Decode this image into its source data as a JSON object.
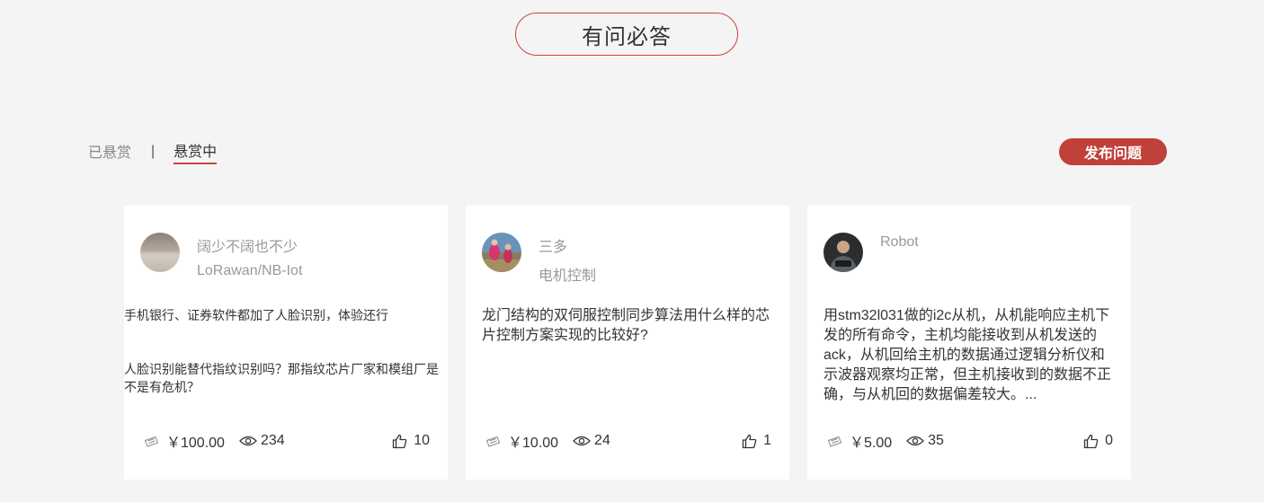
{
  "header": {
    "title": "有问必答"
  },
  "tabs": [
    {
      "label": "已悬赏",
      "active": false
    },
    {
      "label": "悬赏中",
      "active": true
    }
  ],
  "tab_separator": "|",
  "publish_button": {
    "label": "发布问题"
  },
  "colors": {
    "accent": "#c0413a",
    "background": "#f4f4f4",
    "muted_text": "#999999"
  },
  "cards": [
    {
      "user_name": "阔少不阔也不少",
      "user_tag": "LoRawan/NB-Iot",
      "question_paragraphs": [
        "手机银行、证券软件都加了人脸识别，体验还行",
        "人脸识别能替代指纹识别吗？那指纹芯片厂家和模组厂是不是有危机？"
      ],
      "reward": "￥100.00",
      "views": "234",
      "likes": "10"
    },
    {
      "user_name": "三多",
      "user_tag": "电机控制",
      "question": "龙门结构的双伺服控制同步算法用什么样的芯片控制方案实现的比较好?",
      "reward": "￥10.00",
      "views": "24",
      "likes": "1"
    },
    {
      "user_name": "Robot",
      "user_tag": "",
      "question": "用stm32l031做的i2c从机，从机能响应主机下发的所有命令，主机均能接收到从机发送的ack，从机回给主机的数据通过逻辑分析仪和示波器观察均正常，但主机接收到的数据不正确，与从机回的数据偏差较大。...",
      "reward": "￥5.00",
      "views": "35",
      "likes": "0"
    }
  ],
  "icons": {
    "reward": "ticket-icon",
    "views": "eye-icon",
    "likes": "thumbs-up-icon"
  }
}
